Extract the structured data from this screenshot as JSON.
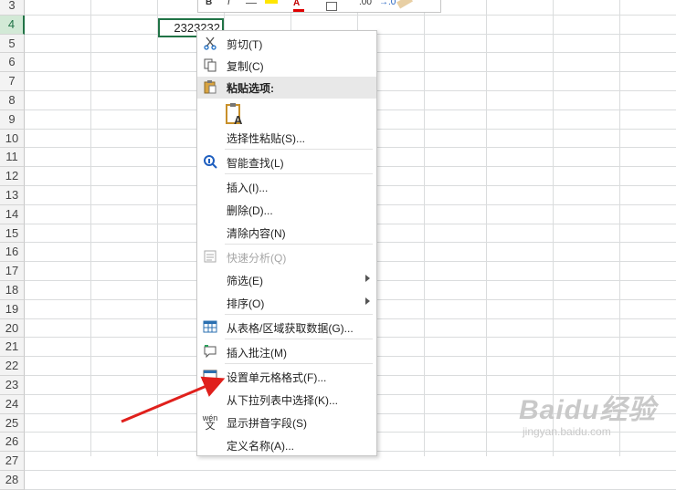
{
  "sheet": {
    "rows": [
      "3",
      "4",
      "5",
      "6",
      "7",
      "8",
      "9",
      "10",
      "11",
      "12",
      "13",
      "14",
      "15",
      "16",
      "17",
      "18",
      "19",
      "20",
      "21",
      "22",
      "23",
      "24",
      "25",
      "26",
      "27",
      "28"
    ],
    "active_row": "4",
    "selected_cell_value": "2323232"
  },
  "minibar": {
    "bold": "B",
    "italic": "I",
    "inc_decimal": ".00",
    "dec_decimal": "→.0"
  },
  "context_menu": {
    "cut": "剪切(T)",
    "copy": "复制(C)",
    "paste_options": "粘贴选项:",
    "paste_special": "选择性粘贴(S)...",
    "smart_lookup": "智能查找(L)",
    "insert": "插入(I)...",
    "delete": "删除(D)...",
    "clear_contents": "清除内容(N)",
    "quick_analysis": "快速分析(Q)",
    "filter": "筛选(E)",
    "sort": "排序(O)",
    "from_table": "从表格/区域获取数据(G)...",
    "insert_comment": "插入批注(M)",
    "format_cells": "设置单元格格式(F)...",
    "pick_from_list": "从下拉列表中选择(K)...",
    "show_phonetic": "显示拼音字段(S)",
    "define_name": "定义名称(A)..."
  },
  "watermark": {
    "brand": "Baidu经验",
    "url": "jingyan.baidu.com"
  }
}
